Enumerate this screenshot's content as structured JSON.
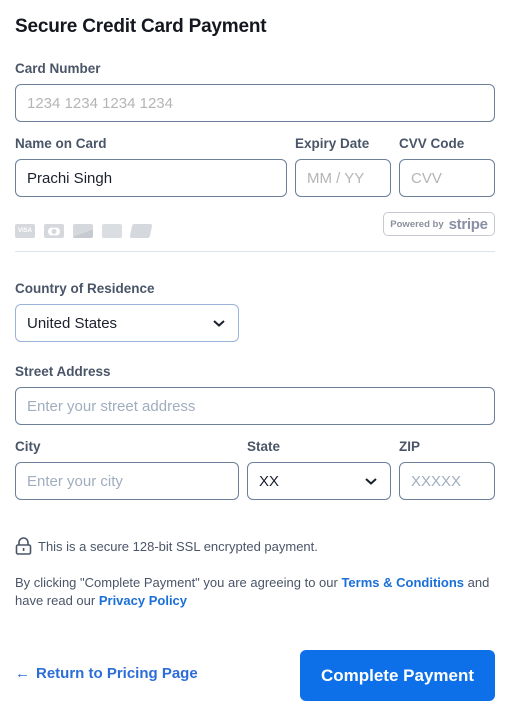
{
  "title": "Secure Credit Card Payment",
  "card_number": {
    "label": "Card Number",
    "value": "",
    "placeholder": "1234 1234 1234 1234"
  },
  "name_on_card": {
    "label": "Name on Card",
    "value": "Prachi Singh",
    "placeholder": ""
  },
  "expiry": {
    "label": "Expiry Date",
    "value": "",
    "placeholder": "MM / YY"
  },
  "cvv": {
    "label": "CVV Code",
    "value": "",
    "placeholder": "CVV"
  },
  "card_brands": [
    {
      "icon": "visa-icon",
      "text": "VISA"
    },
    {
      "icon": "mastercard-icon",
      "text": ""
    },
    {
      "icon": "discover-icon",
      "text": ""
    },
    {
      "icon": "amex-icon",
      "text": ""
    },
    {
      "icon": "unionpay-icon",
      "text": ""
    }
  ],
  "stripe_badge": {
    "prefix": "Powered by",
    "brand": "stripe"
  },
  "country": {
    "label": "Country of Residence",
    "selected": "United States"
  },
  "street": {
    "label": "Street Address",
    "value": "",
    "placeholder": "Enter your street address"
  },
  "city": {
    "label": "City",
    "value": "",
    "placeholder": "Enter your city"
  },
  "state": {
    "label": "State",
    "selected": "XX"
  },
  "zip": {
    "label": "ZIP",
    "value": "",
    "placeholder": "XXXXX"
  },
  "secure_note": "This is a secure 128-bit SSL encrypted payment.",
  "terms": {
    "prefix": "By clicking \"Complete Payment\" you are agreeing to our ",
    "terms_link": "Terms & Conditions",
    "middle": " and have read our ",
    "privacy_link": "Privacy Policy"
  },
  "footer": {
    "back_arrow": "←",
    "back_label": "Return to Pricing Page",
    "submit_label": "Complete Payment"
  },
  "colors": {
    "primary": "#0e70e8",
    "link": "#1a6fd9",
    "label": "#4a5568"
  }
}
